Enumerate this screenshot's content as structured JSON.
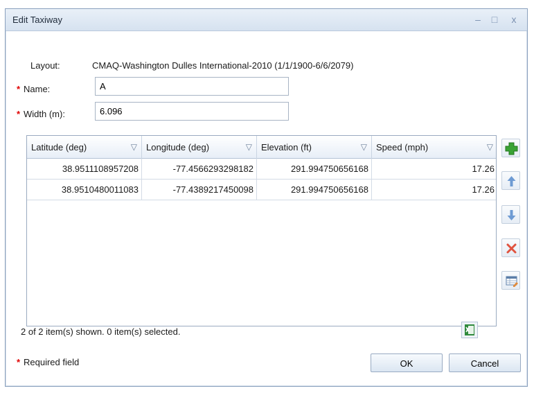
{
  "window": {
    "title": "Edit Taxiway",
    "controls": {
      "minimize": "–",
      "maximize": "□",
      "close": "x"
    }
  },
  "form": {
    "layout_label": "Layout:",
    "layout_value": "CMAQ-Washington Dulles International-2010 (1/1/1900-6/6/2079)",
    "name_label": "Name:",
    "name_value": "A",
    "width_label": "Width (m):",
    "width_value": "6.096",
    "required_star": "*"
  },
  "grid": {
    "columns": [
      "Latitude (deg)",
      "Longitude (deg)",
      "Elevation (ft)",
      "Speed (mph)"
    ],
    "rows": [
      [
        "38.9511108957208",
        "-77.4566293298182",
        "291.994750656168",
        "17.26"
      ],
      [
        "38.9510480011083",
        "-77.4389217450098",
        "291.994750656168",
        "17.26"
      ]
    ]
  },
  "sidebar_icons": [
    "add-icon",
    "move-up-icon",
    "move-down-icon",
    "delete-icon",
    "edit-table-icon"
  ],
  "status_text": "2 of 2 item(s) shown. 0 item(s) selected.",
  "footer": {
    "required_note": "Required field",
    "ok_label": "OK",
    "cancel_label": "Cancel"
  },
  "colors": {
    "add": "#3aa335",
    "arrows": "#6e9bd3",
    "delete": "#e0533f",
    "required": "#e00000",
    "excel": "#2f8a3c"
  }
}
